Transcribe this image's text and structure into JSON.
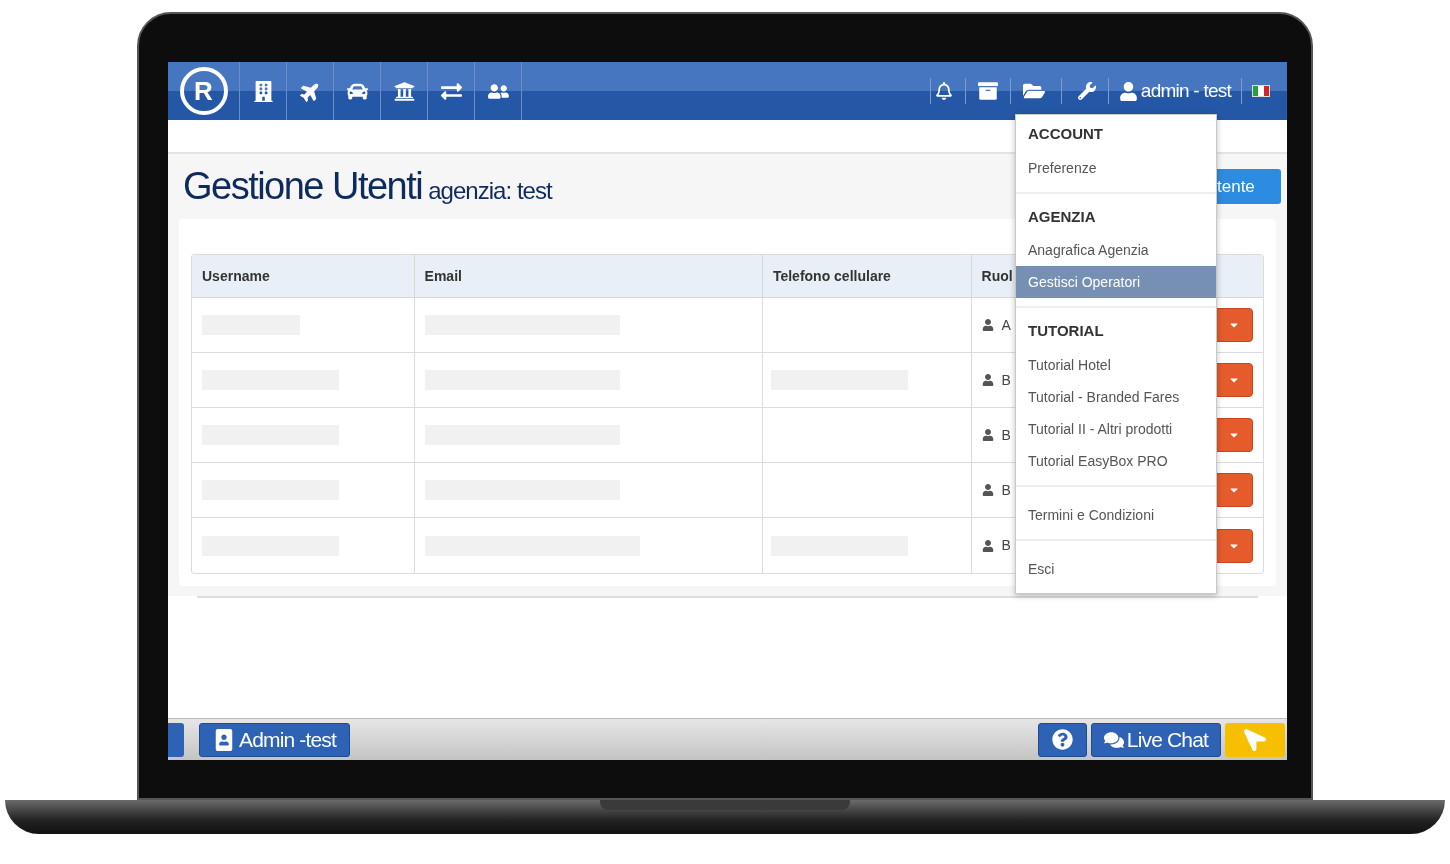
{
  "navbar": {
    "logo_letter": "R",
    "user": "admin - test"
  },
  "page": {
    "title": "Gestione Utenti",
    "subtitle": "agenzia: test",
    "new_button": "tente"
  },
  "table": {
    "columns": [
      "Username",
      "Email",
      "Telefono cellulare",
      "Ruol"
    ],
    "rows": [
      {
        "username_redacted": true,
        "email_redacted": true,
        "phone_redacted": false,
        "role": "A"
      },
      {
        "username_redacted": true,
        "email_redacted": true,
        "phone_redacted": true,
        "role": "B"
      },
      {
        "username_redacted": true,
        "email_redacted": true,
        "phone_redacted": false,
        "role": "B"
      },
      {
        "username_redacted": true,
        "email_redacted": true,
        "phone_redacted": false,
        "role": "B"
      },
      {
        "username_redacted": true,
        "email_redacted": true,
        "phone_redacted": true,
        "role": "B"
      }
    ]
  },
  "dropdown": {
    "sections": [
      {
        "heading": "ACCOUNT",
        "items": [
          {
            "label": "Preferenze",
            "selected": false
          }
        ]
      },
      {
        "heading": "AGENZIA",
        "items": [
          {
            "label": "Anagrafica Agenzia",
            "selected": false
          },
          {
            "label": "Gestisci Operatori",
            "selected": true
          }
        ]
      },
      {
        "heading": "TUTORIAL",
        "items": [
          {
            "label": "Tutorial Hotel",
            "selected": false
          },
          {
            "label": "Tutorial - Branded Fares",
            "selected": false
          },
          {
            "label": "Tutorial II - Altri prodotti",
            "selected": false
          },
          {
            "label": "Tutorial EasyBox PRO",
            "selected": false
          }
        ]
      },
      {
        "items": [
          {
            "label": "Termini e Condizioni",
            "selected": false
          }
        ]
      },
      {
        "items": [
          {
            "label": "Esci",
            "selected": false
          }
        ]
      }
    ]
  },
  "footer": {
    "user_button": "Admin -test",
    "live_chat": "Live Chat"
  }
}
